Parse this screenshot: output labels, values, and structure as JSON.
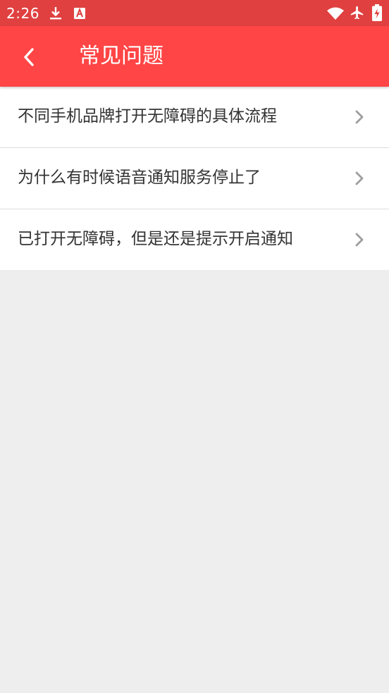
{
  "status_bar": {
    "time": "2:26",
    "icons": [
      "download-icon",
      "a-notification-icon",
      "wifi-icon",
      "airplane-icon",
      "battery-charging-icon"
    ]
  },
  "app_bar": {
    "title": "常见问题",
    "back_icon": "chevron-left-icon"
  },
  "faq": {
    "items": [
      {
        "label": "不同手机品牌打开无障碍的具体流程"
      },
      {
        "label": "为什么有时候语音通知服务停止了"
      },
      {
        "label": "已打开无障碍，但是还是提示开启通知"
      }
    ]
  },
  "colors": {
    "status_bar": "#e04040",
    "app_bar": "#ff4545",
    "background": "#eeeeee",
    "list_background": "#ffffff",
    "text": "#333333",
    "chevron": "#9e9e9e"
  }
}
